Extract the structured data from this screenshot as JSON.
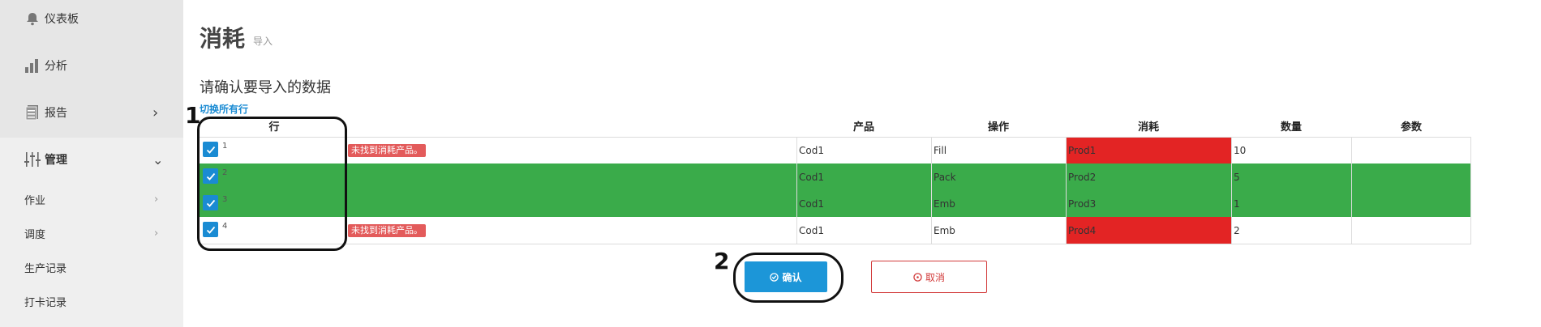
{
  "sidebar": {
    "items": [
      {
        "label": "仪表板",
        "icon": "bell-icon"
      },
      {
        "label": "分析",
        "icon": "bar-chart-icon"
      },
      {
        "label": "报告",
        "icon": "report-icon"
      },
      {
        "label": "管理",
        "icon": "sliders-icon"
      }
    ],
    "subitems": [
      {
        "label": "作业"
      },
      {
        "label": "调度"
      },
      {
        "label": "生产记录"
      },
      {
        "label": "打卡记录"
      }
    ]
  },
  "header": {
    "title": "消耗",
    "subtitle": "导入"
  },
  "main": {
    "section_title": "请确认要导入的数据",
    "toggle_label": "切换所有行",
    "columns": [
      "行",
      "产品",
      "操作",
      "消耗",
      "数量",
      "参数"
    ],
    "rows": [
      {
        "num": "1",
        "error": "未找到消耗产品。",
        "product": "Cod1",
        "operation": "Fill",
        "consumption": "Prod1",
        "quantity": "10",
        "param": "",
        "status": "error"
      },
      {
        "num": "2",
        "error": "",
        "product": "Cod1",
        "operation": "Pack",
        "consumption": "Prod2",
        "quantity": "5",
        "param": "",
        "status": "ok"
      },
      {
        "num": "3",
        "error": "",
        "product": "Cod1",
        "operation": "Emb",
        "consumption": "Prod3",
        "quantity": "1",
        "param": "",
        "status": "ok"
      },
      {
        "num": "4",
        "error": "未找到消耗产品。",
        "product": "Cod1",
        "operation": "Emb",
        "consumption": "Prod4",
        "quantity": "2",
        "param": "",
        "status": "error"
      }
    ],
    "confirm_label": "确认",
    "cancel_label": "取消"
  },
  "annotations": [
    "1",
    "2"
  ],
  "colors": {
    "ok_row": "#3aab4a",
    "error_cell": "#e32424",
    "error_badge": "#e35b5b",
    "primary": "#1c96d8",
    "cancel": "#d23a3a"
  }
}
